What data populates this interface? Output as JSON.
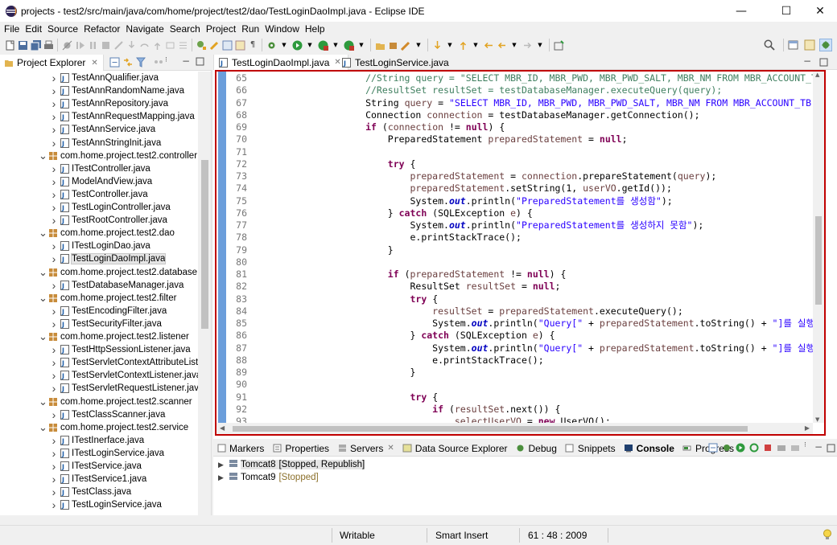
{
  "window": {
    "title": "projects - test2/src/main/java/com/home/project/test2/dao/TestLoginDaoImpl.java - Eclipse IDE",
    "minimize": "—",
    "maximize": "☐",
    "close": "✕"
  },
  "menu": [
    "File",
    "Edit",
    "Source",
    "Refactor",
    "Navigate",
    "Search",
    "Project",
    "Run",
    "Window",
    "Help"
  ],
  "left_panel": {
    "tab_label": "Project Explorer",
    "items": [
      {
        "label": "TestAnnQualifier.java",
        "type": "file",
        "indent": 2
      },
      {
        "label": "TestAnnRandomName.java",
        "type": "file",
        "indent": 2
      },
      {
        "label": "TestAnnRepository.java",
        "type": "file",
        "indent": 2
      },
      {
        "label": "TestAnnRequestMapping.java",
        "type": "file",
        "indent": 2
      },
      {
        "label": "TestAnnService.java",
        "type": "file",
        "indent": 2
      },
      {
        "label": "TestAnnStringInit.java",
        "type": "file",
        "indent": 2
      },
      {
        "label": "com.home.project.test2.controller",
        "type": "package",
        "indent": 1
      },
      {
        "label": "ITestController.java",
        "type": "file",
        "indent": 2
      },
      {
        "label": "ModelAndView.java",
        "type": "file",
        "indent": 2
      },
      {
        "label": "TestController.java",
        "type": "file",
        "indent": 2
      },
      {
        "label": "TestLoginController.java",
        "type": "file",
        "indent": 2
      },
      {
        "label": "TestRootController.java",
        "type": "file",
        "indent": 2
      },
      {
        "label": "com.home.project.test2.dao",
        "type": "package",
        "indent": 1
      },
      {
        "label": "ITestLoginDao.java",
        "type": "file",
        "indent": 2
      },
      {
        "label": "TestLoginDaoImpl.java",
        "type": "file",
        "indent": 2,
        "selected": true
      },
      {
        "label": "com.home.project.test2.database",
        "type": "package",
        "indent": 1
      },
      {
        "label": "TestDatabaseManager.java",
        "type": "file",
        "indent": 2
      },
      {
        "label": "com.home.project.test2.filter",
        "type": "package",
        "indent": 1
      },
      {
        "label": "TestEncodingFilter.java",
        "type": "file",
        "indent": 2
      },
      {
        "label": "TestSecurityFilter.java",
        "type": "file",
        "indent": 2
      },
      {
        "label": "com.home.project.test2.listener",
        "type": "package",
        "indent": 1
      },
      {
        "label": "TestHttpSessionListener.java",
        "type": "file",
        "indent": 2
      },
      {
        "label": "TestServletContextAttributeListe",
        "type": "file",
        "indent": 2
      },
      {
        "label": "TestServletContextListener.java",
        "type": "file",
        "indent": 2
      },
      {
        "label": "TestServletRequestListener.java",
        "type": "file",
        "indent": 2
      },
      {
        "label": "com.home.project.test2.scanner",
        "type": "package",
        "indent": 1
      },
      {
        "label": "TestClassScanner.java",
        "type": "file",
        "indent": 2
      },
      {
        "label": "com.home.project.test2.service",
        "type": "package",
        "indent": 1
      },
      {
        "label": "ITestInerface.java",
        "type": "file",
        "indent": 2
      },
      {
        "label": "ITestLoginService.java",
        "type": "file",
        "indent": 2
      },
      {
        "label": "ITestService.java",
        "type": "file",
        "indent": 2
      },
      {
        "label": "ITestService1.java",
        "type": "file",
        "indent": 2
      },
      {
        "label": "TestClass.java",
        "type": "file",
        "indent": 2
      },
      {
        "label": "TestLoginService.java",
        "type": "file",
        "indent": 2
      }
    ]
  },
  "editor": {
    "tabs": [
      {
        "label": "TestLoginDaoImpl.java",
        "active": true
      },
      {
        "label": "TestLoginService.java",
        "active": false
      }
    ],
    "lines": [
      {
        "n": "65",
        "text": "            //String query = \"SELECT MBR_ID, MBR_PWD, MBR_PWD_SALT, MBR_NM FROM MBR_ACCOUNT_TB WHERE MBR_I"
      },
      {
        "n": "66",
        "text": "            //ResultSet resultSet = testDatabaseManager.executeQuery(query);"
      },
      {
        "n": "67",
        "text": "            String query = \"SELECT MBR_ID, MBR_PWD, MBR_PWD_SALT, MBR_NM FROM MBR_ACCOUNT_TB WHERE MBR_ID"
      },
      {
        "n": "68",
        "text": "            Connection connection = testDatabaseManager.getConnection();"
      },
      {
        "n": "69",
        "text": "            if (connection != null) {"
      },
      {
        "n": "70",
        "text": "                PreparedStatement preparedStatement = null;"
      },
      {
        "n": "71",
        "text": ""
      },
      {
        "n": "72",
        "text": "                try {"
      },
      {
        "n": "73",
        "text": "                    preparedStatement = connection.prepareStatement(query);"
      },
      {
        "n": "74",
        "text": "                    preparedStatement.setString(1, userVO.getId());"
      },
      {
        "n": "75",
        "text": "                    System.out.println(\"PreparedStatement를 생성함\");"
      },
      {
        "n": "76",
        "text": "                } catch (SQLException e) {"
      },
      {
        "n": "77",
        "text": "                    System.out.println(\"PreparedStatement를 생성하지 못함\");"
      },
      {
        "n": "78",
        "text": "                    e.printStackTrace();"
      },
      {
        "n": "79",
        "text": "                }"
      },
      {
        "n": "80",
        "text": ""
      },
      {
        "n": "81",
        "text": "                if (preparedStatement != null) {"
      },
      {
        "n": "82",
        "text": "                    ResultSet resultSet = null;"
      },
      {
        "n": "83",
        "text": "                    try {"
      },
      {
        "n": "84",
        "text": "                        resultSet = preparedStatement.executeQuery();"
      },
      {
        "n": "85",
        "text": "                        System.out.println(\"Query[\" + preparedStatement.toString() + \"]를 실행함\");"
      },
      {
        "n": "86",
        "text": "                    } catch (SQLException e) {"
      },
      {
        "n": "87",
        "text": "                        System.out.println(\"Query[\" + preparedStatement.toString() + \"]를 실행하지 못함\");"
      },
      {
        "n": "88",
        "text": "                        e.printStackTrace();"
      },
      {
        "n": "89",
        "text": "                    }"
      },
      {
        "n": "90",
        "text": ""
      },
      {
        "n": "91",
        "text": "                    try {"
      },
      {
        "n": "92",
        "text": "                        if (resultSet.next()) {"
      },
      {
        "n": "93",
        "text": "                            selectUserVO = new UserVO();"
      }
    ]
  },
  "bottom_panel": {
    "tabs": [
      {
        "label": "Markers",
        "bold": false
      },
      {
        "label": "Properties",
        "bold": false
      },
      {
        "label": "Servers",
        "bold": false
      },
      {
        "label": "Data Source Explorer",
        "bold": false
      },
      {
        "label": "Debug",
        "bold": false
      },
      {
        "label": "Snippets",
        "bold": false
      },
      {
        "label": "Console",
        "bold": true
      },
      {
        "label": "Progress",
        "bold": false
      }
    ],
    "servers": [
      {
        "name": "Tomcat8",
        "status": "[Stopped, Republish]",
        "selected": true
      },
      {
        "name": "Tomcat9",
        "status": "[Stopped]",
        "selected": false
      }
    ]
  },
  "status_bar": {
    "mode": "Writable",
    "insert": "Smart Insert",
    "position": "61 : 48 : 2009"
  }
}
